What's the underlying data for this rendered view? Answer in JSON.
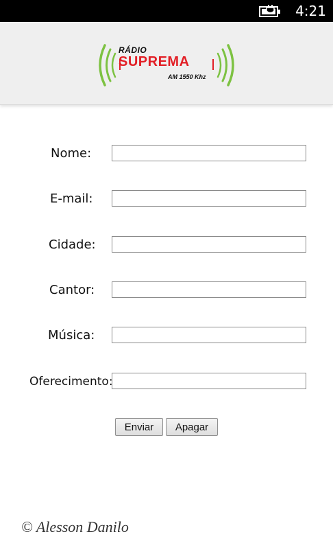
{
  "status_bar": {
    "time": "4:21",
    "battery_icon": "battery-charging-icon"
  },
  "header": {
    "logo": {
      "line1": "RÁDIO",
      "line2": "SUPREMA",
      "line3": "AM 1550 Khz",
      "colors": {
        "waves": "#7dc242",
        "name": "#e21f26"
      }
    }
  },
  "form": {
    "fields": [
      {
        "label": "Nome:",
        "value": ""
      },
      {
        "label": "E-mail:",
        "value": ""
      },
      {
        "label": "Cidade:",
        "value": ""
      },
      {
        "label": "Cantor:",
        "value": ""
      },
      {
        "label": "Música:",
        "value": ""
      },
      {
        "label": "Oferecimento:",
        "value": ""
      }
    ],
    "submit_label": "Enviar",
    "clear_label": "Apagar"
  },
  "footer": {
    "credit": "© Alesson Danilo"
  }
}
